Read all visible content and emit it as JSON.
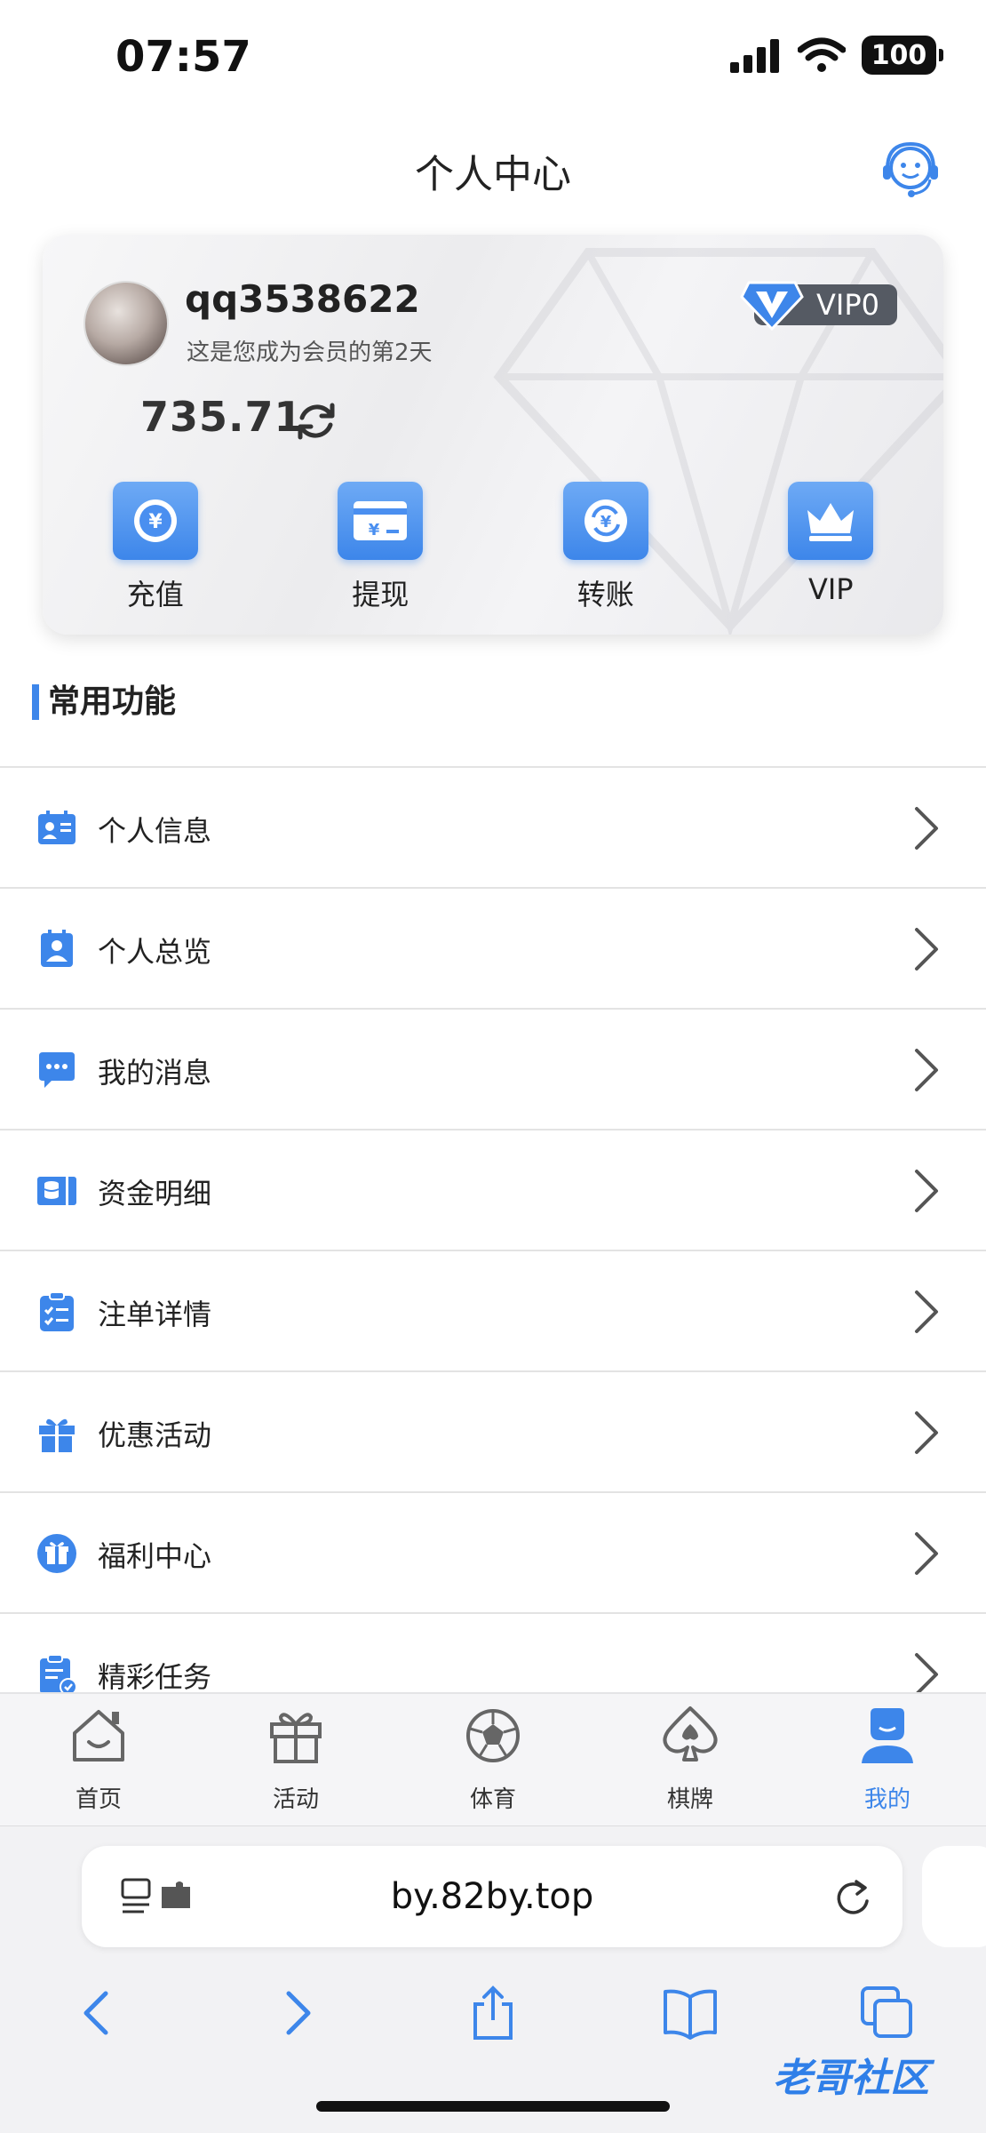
{
  "status_bar": {
    "time": "07:57",
    "battery": "100"
  },
  "header": {
    "title": "个人中心",
    "support_icon": "customer-service-icon"
  },
  "profile": {
    "username": "qq3538622",
    "member_days": "这是您成为会员的第2天",
    "vip_level": "VIP0",
    "balance": "735.71"
  },
  "quick_actions": [
    {
      "label": "充值",
      "icon": "yen-coin-icon"
    },
    {
      "label": "提现",
      "icon": "card-yen-icon"
    },
    {
      "label": "转账",
      "icon": "transfer-icon"
    },
    {
      "label": "VIP",
      "icon": "crown-icon"
    }
  ],
  "section": {
    "title": "常用功能"
  },
  "menu": [
    {
      "label": "个人信息",
      "icon": "id-card-icon"
    },
    {
      "label": "个人总览",
      "icon": "user-badge-icon"
    },
    {
      "label": "我的消息",
      "icon": "chat-bubble-icon"
    },
    {
      "label": "资金明细",
      "icon": "money-ticket-icon"
    },
    {
      "label": "注单详情",
      "icon": "clipboard-check-icon"
    },
    {
      "label": "优惠活动",
      "icon": "gift-icon"
    },
    {
      "label": "福利中心",
      "icon": "gift-circle-icon"
    },
    {
      "label": "精彩任务",
      "icon": "task-clipboard-icon"
    }
  ],
  "tabbar": [
    {
      "label": "首页",
      "icon": "home-icon",
      "active": false
    },
    {
      "label": "活动",
      "icon": "gift-box-icon",
      "active": false
    },
    {
      "label": "体育",
      "icon": "football-icon",
      "active": false
    },
    {
      "label": "棋牌",
      "icon": "spade-icon",
      "active": false
    },
    {
      "label": "我的",
      "icon": "user-icon",
      "active": true
    }
  ],
  "browser": {
    "url": "by.82by.top"
  },
  "watermark": {
    "text": "老哥社区"
  },
  "colors": {
    "accent": "#3d86ea",
    "vip_badge": "#555a63"
  }
}
